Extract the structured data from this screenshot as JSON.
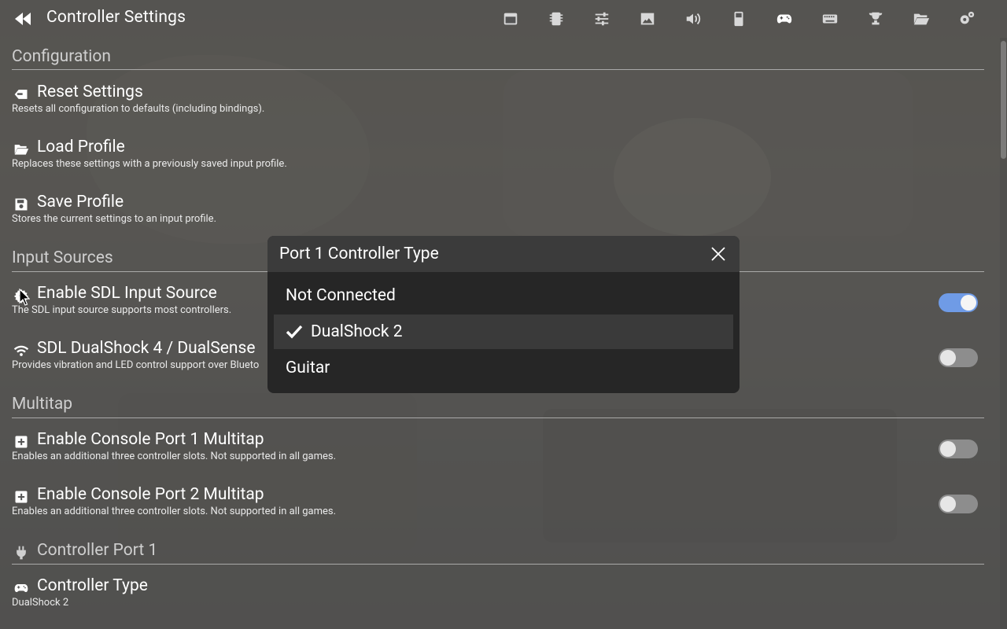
{
  "header": {
    "title": "Controller Settings",
    "back_icon": "double-chevron-left-icon",
    "nav_icons": [
      {
        "name": "summary-icon"
      },
      {
        "name": "chip-icon"
      },
      {
        "name": "sliders-icon"
      },
      {
        "name": "image-icon"
      },
      {
        "name": "volume-icon"
      },
      {
        "name": "memory-card-icon"
      },
      {
        "name": "gamepad-icon",
        "active": true
      },
      {
        "name": "keyboard-icon"
      },
      {
        "name": "trophy-icon"
      },
      {
        "name": "folder-icon"
      },
      {
        "name": "advanced-gears-icon"
      }
    ]
  },
  "sections": {
    "configuration": "Configuration",
    "input_sources": "Input Sources",
    "multitap": "Multitap",
    "controller_port_1": "Controller Port 1"
  },
  "items": {
    "reset": {
      "label": "Reset Settings",
      "desc": "Resets all configuration to defaults (including bindings)."
    },
    "load": {
      "label": "Load Profile",
      "desc": "Replaces these settings with a previously saved input profile."
    },
    "save": {
      "label": "Save Profile",
      "desc": "Stores the current settings to an input profile."
    },
    "sdl": {
      "label": "Enable SDL Input Source",
      "desc": "The SDL input source supports most controllers.",
      "enabled": true
    },
    "ds4": {
      "label": "SDL DualShock 4 / DualSense",
      "desc": "Provides vibration and LED control support over Blueto",
      "enabled": false
    },
    "mt1": {
      "label": "Enable Console Port 1 Multitap",
      "desc": "Enables an additional three controller slots. Not supported in all games.",
      "enabled": false
    },
    "mt2": {
      "label": "Enable Console Port 2 Multitap",
      "desc": "Enables an additional three controller slots. Not supported in all games.",
      "enabled": false
    },
    "ctype": {
      "label": "Controller Type",
      "value": "DualShock 2"
    }
  },
  "modal": {
    "title": "Port 1 Controller Type",
    "options": [
      "Not Connected",
      "DualShock 2",
      "Guitar"
    ],
    "selected": "DualShock 2"
  },
  "colors": {
    "toggle_on": "#6f9be6",
    "toggle_off": "#8d8d8d",
    "modal_bg": "#262626"
  }
}
